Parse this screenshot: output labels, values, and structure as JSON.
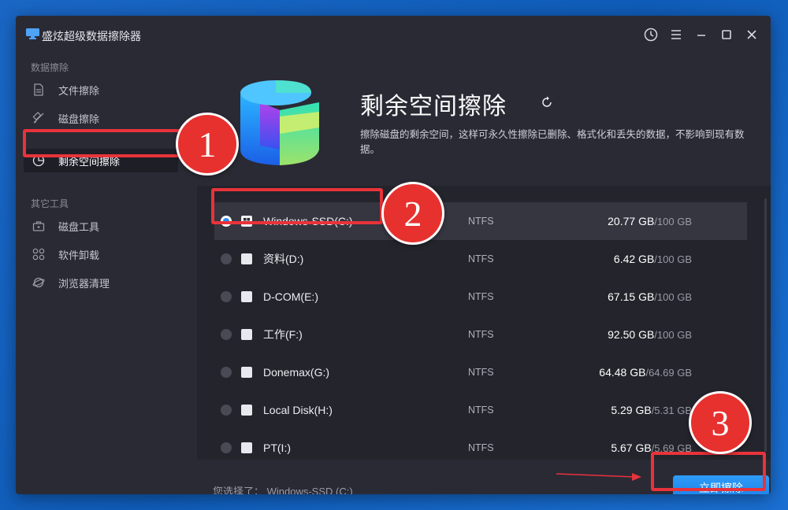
{
  "window": {
    "title": "盛炫超级数据擦除器"
  },
  "sidebar": {
    "section1_label": "数据擦除",
    "items1": [
      {
        "label": "文件擦除",
        "icon": "file-icon"
      },
      {
        "label": "磁盘擦除",
        "icon": "disk-icon"
      },
      {
        "label": "剩余空间擦除",
        "icon": "pie-icon"
      }
    ],
    "section2_label": "其它工具",
    "items2": [
      {
        "label": "磁盘工具",
        "icon": "toolbox-icon"
      },
      {
        "label": "软件卸载",
        "icon": "apps-icon"
      },
      {
        "label": "浏览器清理",
        "icon": "browser-icon"
      }
    ]
  },
  "main": {
    "title": "剩余空间擦除",
    "description": "擦除磁盘的剩余空间，这样可永久性擦除已删除、格式化和丢失的数据，不影响到现有数据。"
  },
  "drives": [
    {
      "name": "Windows-SSD(C:)",
      "fs": "NTFS",
      "used": "20.77 GB",
      "total": "/100 GB",
      "selected": true
    },
    {
      "name": "资料(D:)",
      "fs": "NTFS",
      "used": "6.42 GB",
      "total": "/100 GB",
      "selected": false
    },
    {
      "name": "D-COM(E:)",
      "fs": "NTFS",
      "used": "67.15 GB",
      "total": "/100 GB",
      "selected": false
    },
    {
      "name": "工作(F:)",
      "fs": "NTFS",
      "used": "92.50 GB",
      "total": "/100 GB",
      "selected": false
    },
    {
      "name": "Donemax(G:)",
      "fs": "NTFS",
      "used": "64.48 GB",
      "total": "/64.69 GB",
      "selected": false
    },
    {
      "name": "Local Disk(H:)",
      "fs": "NTFS",
      "used": "5.29 GB",
      "total": "/5.31 GB",
      "selected": false
    },
    {
      "name": "PT(I:)",
      "fs": "NTFS",
      "used": "5.67 GB",
      "total": "/5.69 GB",
      "selected": false
    }
  ],
  "footer": {
    "selected_label": "您选择了：  Windows-SSD (C:)",
    "erase_button": "立即擦除"
  },
  "annotations": {
    "step1": "1",
    "step2": "2",
    "step3": "3"
  },
  "colors": {
    "accent": "#2b8cf5",
    "annotation_red": "#e7312f"
  }
}
